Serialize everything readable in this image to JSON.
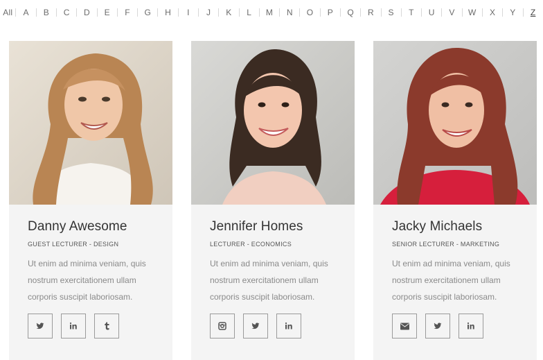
{
  "alphabet_filter": [
    "All",
    "A",
    "B",
    "C",
    "D",
    "E",
    "F",
    "G",
    "H",
    "I",
    "J",
    "K",
    "L",
    "M",
    "N",
    "O",
    "P",
    "Q",
    "R",
    "S",
    "T",
    "U",
    "V",
    "W",
    "X",
    "Y",
    "Z"
  ],
  "active_letter": "Z",
  "people": [
    {
      "name": "Danny Awesome",
      "role": "GUEST LECTURER - DESIGN",
      "bio": "Ut enim ad minima veniam, quis nostrum exercitationem ullam corporis suscipit laboriosam.",
      "socials": [
        "twitter-icon",
        "linkedin-icon",
        "tumblr-icon"
      ]
    },
    {
      "name": "Jennifer Homes",
      "role": "LECTURER - ECONOMICS",
      "bio": "Ut enim ad minima veniam, quis nostrum exercitationem ullam corporis suscipit laboriosam.",
      "socials": [
        "instagram-icon",
        "twitter-icon",
        "linkedin-icon"
      ]
    },
    {
      "name": "Jacky Michaels",
      "role": "SENIOR LECTURER - MARKETING",
      "bio": "Ut enim ad minima veniam, quis nostrum exercitationem ullam corporis suscipit laboriosam.",
      "socials": [
        "email-icon",
        "twitter-icon",
        "linkedin-icon"
      ]
    }
  ],
  "colors": {
    "card_bg": "#f4f4f4",
    "text_dark": "#333333",
    "text_muted": "#8a8a8a",
    "icon_border": "#9a9a9a"
  }
}
